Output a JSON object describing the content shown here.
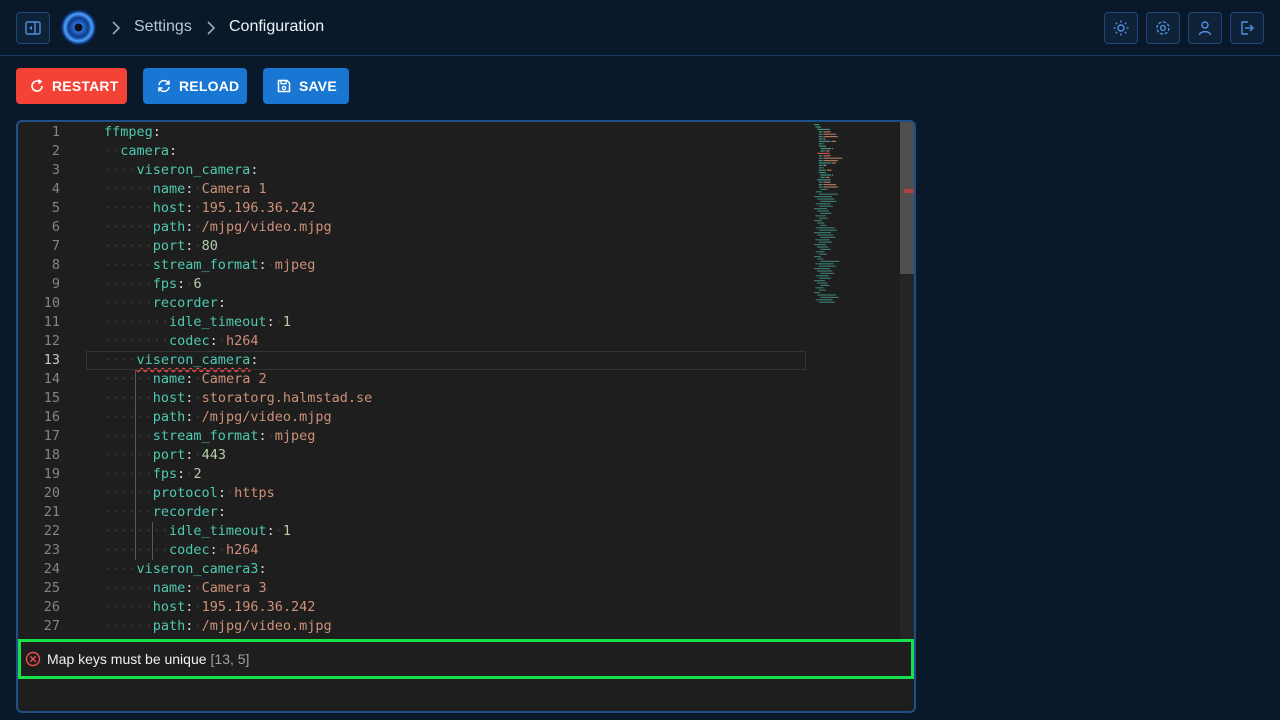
{
  "breadcrumb": {
    "settings": "Settings",
    "configuration": "Configuration"
  },
  "toolbar": {
    "restart_label": "RESTART",
    "reload_label": "RELOAD",
    "save_label": "SAVE"
  },
  "colors": {
    "restart": "#f44336",
    "reload": "#1976d2",
    "save": "#1976d2",
    "highlight_box": "#16e04a"
  },
  "header_icons": [
    "sidebar-toggle-icon",
    "theme-brightness-icon",
    "settings-gear-icon",
    "user-icon",
    "logout-icon"
  ],
  "editor": {
    "active_line": 13,
    "lines": [
      {
        "n": "1",
        "indent": 0,
        "key": "ffmpeg",
        "value": ""
      },
      {
        "n": "2",
        "indent": 1,
        "key": "camera",
        "value": ""
      },
      {
        "n": "3",
        "indent": 2,
        "key": "viseron_camera",
        "value": ""
      },
      {
        "n": "4",
        "indent": 3,
        "key": "name",
        "value": "Camera 1",
        "vtype": "str"
      },
      {
        "n": "5",
        "indent": 3,
        "key": "host",
        "value": "195.196.36.242",
        "vtype": "str"
      },
      {
        "n": "6",
        "indent": 3,
        "key": "path",
        "value": "/mjpg/video.mjpg",
        "vtype": "str"
      },
      {
        "n": "7",
        "indent": 3,
        "key": "port",
        "value": "80",
        "vtype": "num"
      },
      {
        "n": "8",
        "indent": 3,
        "key": "stream_format",
        "value": "mjpeg",
        "vtype": "str"
      },
      {
        "n": "9",
        "indent": 3,
        "key": "fps",
        "value": "6",
        "vtype": "num"
      },
      {
        "n": "10",
        "indent": 3,
        "key": "recorder",
        "value": ""
      },
      {
        "n": "11",
        "indent": 4,
        "key": "idle_timeout",
        "value": "1",
        "vtype": "num"
      },
      {
        "n": "12",
        "indent": 4,
        "key": "codec",
        "value": "h264",
        "vtype": "str"
      },
      {
        "n": "13",
        "indent": 2,
        "key": "viseron_camera",
        "value": "",
        "error": true
      },
      {
        "n": "14",
        "indent": 3,
        "key": "name",
        "value": "Camera 2",
        "vtype": "str"
      },
      {
        "n": "15",
        "indent": 3,
        "key": "host",
        "value": "storatorg.halmstad.se",
        "vtype": "str"
      },
      {
        "n": "16",
        "indent": 3,
        "key": "path",
        "value": "/mjpg/video.mjpg",
        "vtype": "str"
      },
      {
        "n": "17",
        "indent": 3,
        "key": "stream_format",
        "value": "mjpeg",
        "vtype": "str"
      },
      {
        "n": "18",
        "indent": 3,
        "key": "port",
        "value": "443",
        "vtype": "num"
      },
      {
        "n": "19",
        "indent": 3,
        "key": "fps",
        "value": "2",
        "vtype": "num"
      },
      {
        "n": "20",
        "indent": 3,
        "key": "protocol",
        "value": "https",
        "vtype": "str"
      },
      {
        "n": "21",
        "indent": 3,
        "key": "recorder",
        "value": ""
      },
      {
        "n": "22",
        "indent": 4,
        "key": "idle_timeout",
        "value": "1",
        "vtype": "num"
      },
      {
        "n": "23",
        "indent": 4,
        "key": "codec",
        "value": "h264",
        "vtype": "str"
      },
      {
        "n": "24",
        "indent": 2,
        "key": "viseron_camera3",
        "value": ""
      },
      {
        "n": "25",
        "indent": 3,
        "key": "name",
        "value": "Camera 3",
        "vtype": "str"
      },
      {
        "n": "26",
        "indent": 3,
        "key": "host",
        "value": "195.196.36.242",
        "vtype": "str"
      },
      {
        "n": "27",
        "indent": 3,
        "key": "path",
        "value": "/mjpg/video.mjpg",
        "vtype": "str"
      }
    ]
  },
  "problems": {
    "message": "Map keys must be unique",
    "location": "[13, 5]"
  }
}
